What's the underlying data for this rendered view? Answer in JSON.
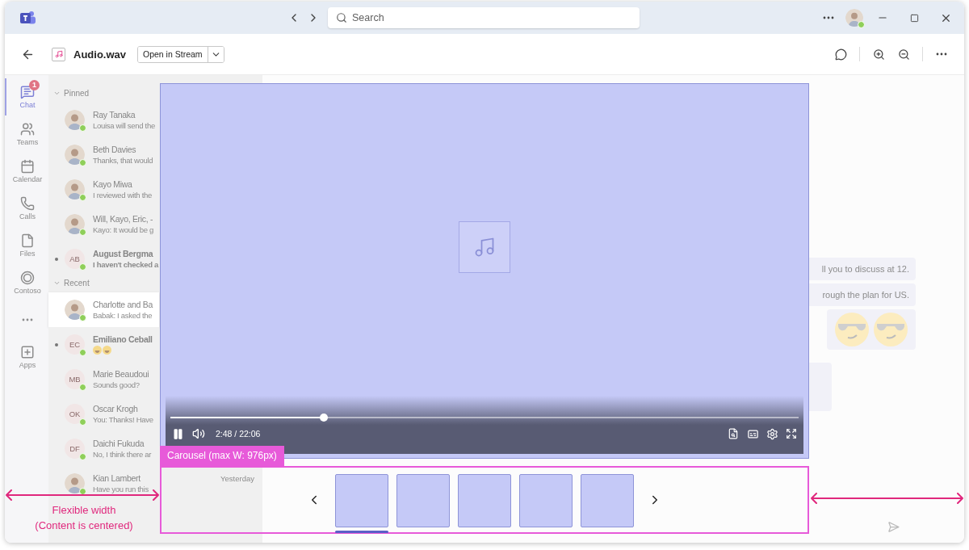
{
  "title_bar": {
    "search": {
      "placeholder": "Search"
    }
  },
  "header": {
    "file_name": "Audio.wav",
    "open_button": "Open in Stream"
  },
  "rail": [
    {
      "label": "Chat",
      "badge": "1",
      "selected": true
    },
    {
      "label": "Teams",
      "selected": false
    },
    {
      "label": "Calendar",
      "selected": false
    },
    {
      "label": "Calls",
      "selected": false
    },
    {
      "label": "Files",
      "selected": false
    },
    {
      "label": "Contoso",
      "selected": false
    },
    {
      "kind": "more",
      "selected": false
    },
    {
      "label": "Apps",
      "selected": false
    }
  ],
  "chat_list": [
    {
      "title": "Pinned",
      "expanded": true,
      "items": [
        {
          "name": "Ray Tanaka",
          "preview": {
            "kind": "text",
            "text": "Louisa will send the"
          },
          "avatar": {
            "kind": "photo"
          },
          "unread": false,
          "selected": false
        },
        {
          "name": "Beth Davies",
          "preview": {
            "kind": "text",
            "text": "Thanks, that would"
          },
          "avatar": {
            "kind": "photo"
          },
          "unread": false,
          "selected": false
        },
        {
          "name": "Kayo Miwa",
          "preview": {
            "kind": "text",
            "text": "I reviewed with the"
          },
          "avatar": {
            "kind": "photo"
          },
          "unread": false,
          "selected": false
        },
        {
          "name": "Will, Kayo, Eric, -",
          "preview": {
            "kind": "text",
            "text": "Kayo: It would be g"
          },
          "avatar": {
            "kind": "photo"
          },
          "unread": false,
          "selected": false
        },
        {
          "name": "August Bergma",
          "preview": {
            "kind": "text",
            "text": "I haven't checked a"
          },
          "avatar": {
            "kind": "initials",
            "initials": "AB"
          },
          "unread": true,
          "selected": false
        }
      ]
    },
    {
      "title": "Recent",
      "expanded": true,
      "items": [
        {
          "name": "Charlotte and Ba",
          "preview": {
            "kind": "text",
            "text": "Babak: I asked the"
          },
          "avatar": {
            "kind": "photo"
          },
          "unread": false,
          "selected": true
        },
        {
          "name": "Emiliano Ceball",
          "preview": {
            "kind": "emoji"
          },
          "avatar": {
            "kind": "initials",
            "initials": "EC"
          },
          "unread": true,
          "selected": false
        },
        {
          "name": "Marie Beaudoui",
          "preview": {
            "kind": "text",
            "text": "Sounds good?"
          },
          "avatar": {
            "kind": "initials",
            "initials": "MB"
          },
          "unread": false,
          "selected": false
        },
        {
          "name": "Oscar Krogh",
          "preview": {
            "kind": "text",
            "text": "You: Thanks! Have"
          },
          "avatar": {
            "kind": "initials",
            "initials": "OK"
          },
          "unread": false,
          "selected": false
        },
        {
          "name": "Daichi Fukuda",
          "preview": {
            "kind": "text",
            "text": "No, I think there ar"
          },
          "avatar": {
            "kind": "initials",
            "initials": "DF"
          },
          "unread": false,
          "selected": false
        },
        {
          "name": "Kian Lambert",
          "preview": {
            "kind": "text",
            "text": "Have you run this"
          },
          "time": "Yesterday",
          "avatar": {
            "kind": "photo"
          },
          "unread": false,
          "selected": false
        }
      ]
    }
  ],
  "messages": [
    {
      "kind": "text",
      "text": "ll you to discuss at 12."
    },
    {
      "kind": "text",
      "text": "rough the plan for US."
    },
    {
      "kind": "stickers"
    },
    {
      "kind": "blank"
    }
  ],
  "player": {
    "playing": true,
    "level": 0.244,
    "time": "2:48 / 22:06"
  },
  "carousel": {
    "label": "Carousel (max W: 976px)",
    "thumbnails": [
      {
        "selected": true
      },
      {
        "selected": false
      },
      {
        "selected": false
      },
      {
        "selected": false
      },
      {
        "selected": false
      }
    ]
  },
  "annotation": {
    "lines": [
      "Flexible width",
      "(Content is centered)"
    ]
  }
}
